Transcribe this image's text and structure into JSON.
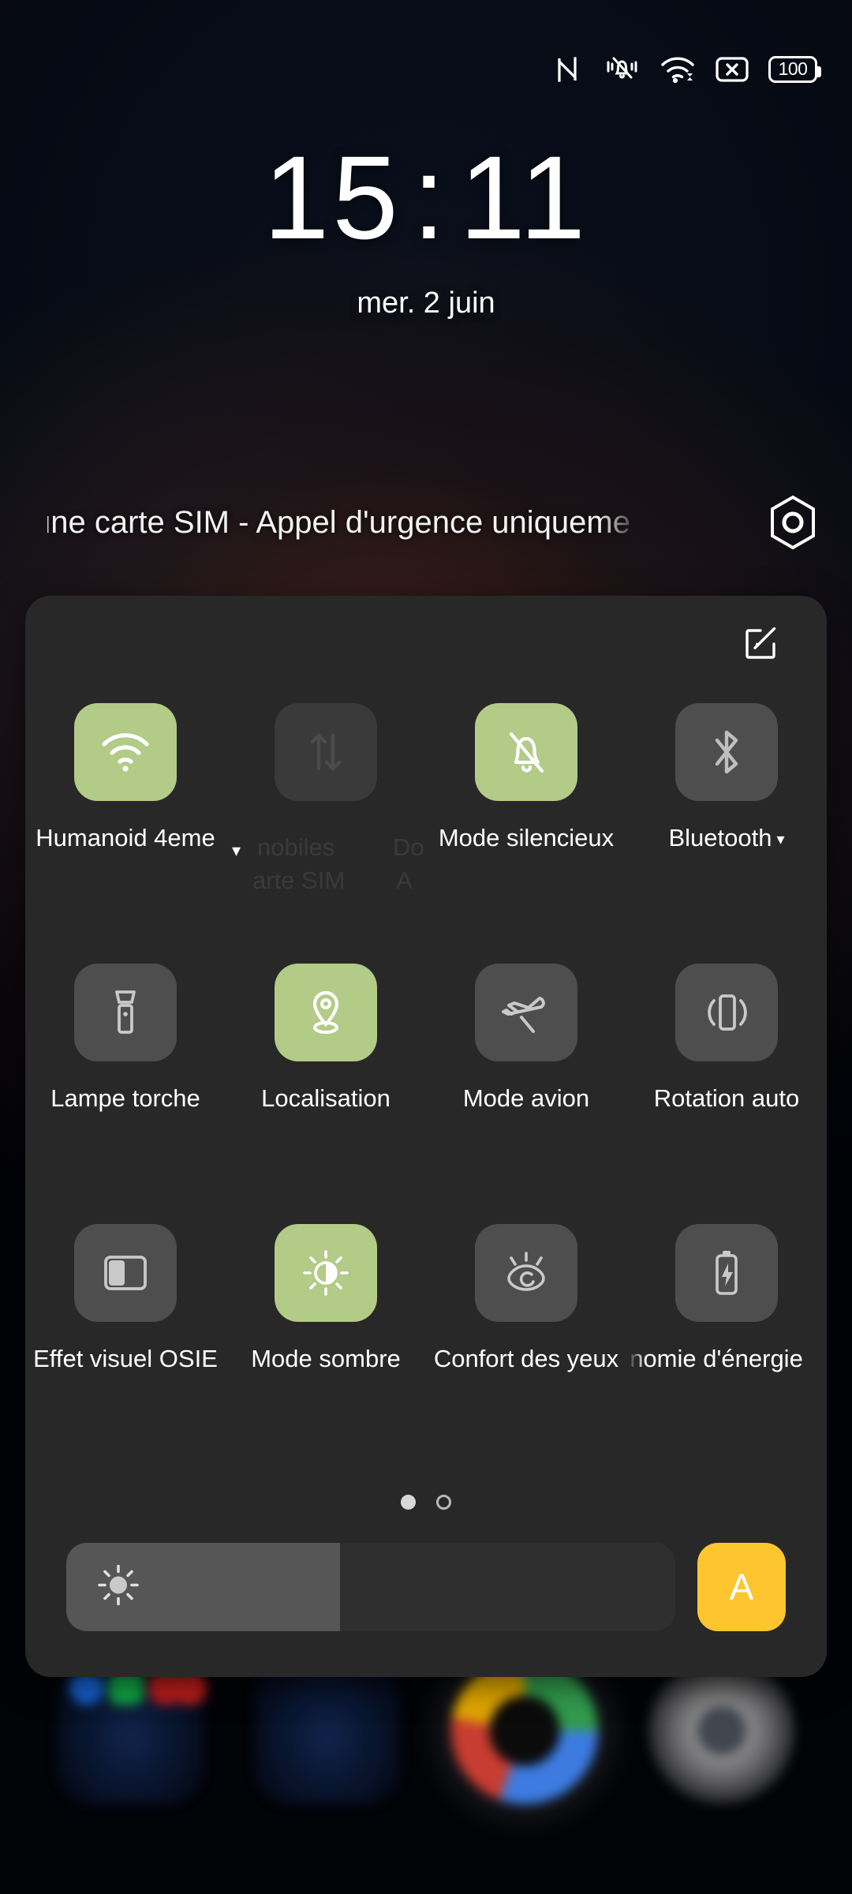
{
  "statusbar": {
    "icons": [
      "nfc-icon",
      "silent-vibrate-icon",
      "wifi-icon",
      "no-sim-icon",
      "battery-icon"
    ],
    "battery_level": "100"
  },
  "lockscreen": {
    "time_hours": "15",
    "time_separator": ":",
    "time_minutes": "11",
    "date": "mer. 2 juin",
    "carrier_text": "une carte SIM - Appel d'urgence uniqueme",
    "carrier_action_icon": "hexagon-settings-icon"
  },
  "quick_settings": {
    "edit_button_icon": "edit-pencil-square-icon",
    "accent_on_color": "#b2cb87",
    "tile_off_color": "#4e4e4e",
    "panel_color": "#282828",
    "tiles": [
      {
        "name": "wifi",
        "icon": "wifi-icon",
        "label": "Humanoid 4eme",
        "state": "on",
        "has_caret": true
      },
      {
        "name": "mobile-data",
        "icon": "data-arrows-icon",
        "label": "Données mobiles",
        "state": "dim",
        "has_caret": true,
        "ghost_top": "nobiles",
        "ghost_bottom": "arte SIM",
        "ghost2_top": "Do",
        "ghost2_bottom": "A"
      },
      {
        "name": "silent-mode",
        "icon": "bell-off-icon",
        "label": "Mode silencieux",
        "state": "on",
        "has_caret": false
      },
      {
        "name": "bluetooth",
        "icon": "bluetooth-icon",
        "label": "Bluetooth",
        "state": "off",
        "has_caret": true
      },
      {
        "name": "flashlight",
        "icon": "flashlight-icon",
        "label": "Lampe torche",
        "state": "off",
        "has_caret": false
      },
      {
        "name": "location",
        "icon": "location-pin-icon",
        "label": "Localisation",
        "state": "on",
        "has_caret": false
      },
      {
        "name": "airplane",
        "icon": "airplane-icon",
        "label": "Mode avion",
        "state": "off",
        "has_caret": false
      },
      {
        "name": "auto-rotate",
        "icon": "rotate-phone-icon",
        "label": "Rotation auto",
        "state": "off",
        "has_caret": false
      },
      {
        "name": "osie",
        "icon": "split-screen-icon",
        "label": "Effet visuel OSIE",
        "state": "off",
        "has_caret": false
      },
      {
        "name": "dark-mode",
        "icon": "sun-contrast-icon",
        "label": "Mode sombre",
        "state": "on",
        "has_caret": false
      },
      {
        "name": "eye-comfort",
        "icon": "eye-comfort-icon",
        "label": "Confort des yeux",
        "state": "off",
        "has_caret": false
      },
      {
        "name": "power-save",
        "icon": "battery-bolt-icon",
        "label": "nomie d'énergie",
        "state": "off",
        "has_caret": false,
        "clipped": true
      }
    ],
    "pages": {
      "count": 2,
      "current": 1
    },
    "brightness": {
      "icon": "brightness-sun-icon",
      "value_percent": 45,
      "auto_label": "A",
      "auto_color": "#fdc62e",
      "auto_enabled": true
    }
  },
  "dock": {
    "apps": [
      {
        "name": "folder-tools",
        "kind": "folder-blue",
        "mini_colors": [
          "#2b7fff",
          "#12b44c",
          "#d32020",
          "#d32020"
        ]
      },
      {
        "name": "folder-second",
        "kind": "folder-blue",
        "mini_colors": []
      },
      {
        "name": "google-app",
        "kind": "google",
        "mini_colors": []
      },
      {
        "name": "grey-app",
        "kind": "grey",
        "mini_colors": []
      }
    ]
  }
}
